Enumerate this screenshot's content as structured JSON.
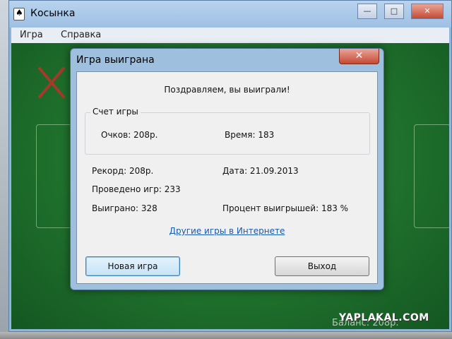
{
  "window": {
    "title": "Косынка",
    "minimize": "—",
    "maximize": "□",
    "close": "✕"
  },
  "menu": {
    "items": [
      {
        "label": "Игра"
      },
      {
        "label": "Справка"
      }
    ]
  },
  "dialog": {
    "title": "Игра выиграна",
    "close": "✕",
    "congrats": "Поздравляем, вы выиграли!",
    "score_group": {
      "legend": "Счет игры",
      "points": "Очков: 208р.",
      "time": "Время:  183"
    },
    "stats": {
      "record": "Рекорд: 208р.",
      "date": "Дата: 21.09.2013",
      "played": "Проведено игр: 233",
      "won": "Выиграно: 328",
      "percent": "Процент выигрышей: 183 %"
    },
    "link": "Другие игры в Интернете",
    "buttons": {
      "new_game": "Новая игра",
      "exit": "Выход"
    }
  },
  "overlay": {
    "watermark": "YAPLAKAL.COM",
    "balance": "Баланс: 208р."
  }
}
